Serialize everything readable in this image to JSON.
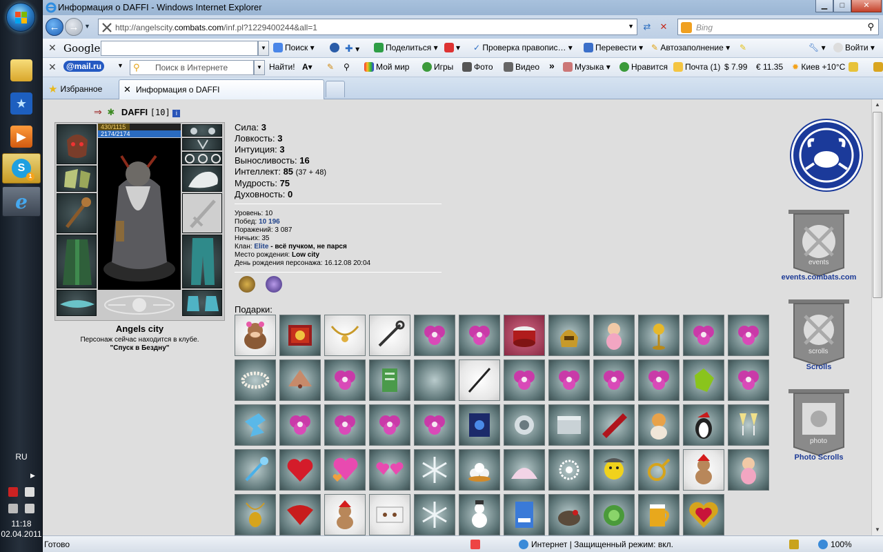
{
  "window": {
    "title": "Информация о DAFFI - Windows Internet Explorer",
    "minimize": "▁",
    "maximize": "□",
    "close": "✕"
  },
  "address": {
    "prefix": "http://angelscity.",
    "host": "combats.com",
    "path": "/inf.pl?1229400244&all=1"
  },
  "search": {
    "placeholder": "Bing"
  },
  "google_toolbar": {
    "logo": "Google",
    "search_label": "Поиск",
    "share_label": "Поделиться",
    "spellcheck_label": "Проверка правопис…",
    "translate_label": "Перевести",
    "autofill_label": "Автозаполнение",
    "login_label": "Войти"
  },
  "mail_toolbar": {
    "logo": "@mail.ru",
    "search_placeholder": "Поиск в Интернете",
    "go_label": "Найти!",
    "myworld_label": "Мой мир",
    "games_label": "Игры",
    "photo_label": "Фото",
    "video_label": "Видео",
    "more_label": "»",
    "music_label": "Музыка",
    "like_label": "Нравится",
    "mail_label": "Почта (1)",
    "usd_label": "$ 7.99",
    "eur_label": "€ 11.35",
    "weather_label": "Киев +10°C"
  },
  "tabs": {
    "favorites_label": "Избранное",
    "active_label": "Информация о DAFFI"
  },
  "character": {
    "name": "DAFFI",
    "level": "[10]",
    "info_icon": "i",
    "hp_text": "430/1115",
    "hp_fraction": 0.386,
    "mp_text": "2174/2174",
    "city_name": "Angels city",
    "location_text": "Персонаж сейчас находится в клубе.",
    "location_name": "\"Спуск в Бездну\""
  },
  "stats": [
    {
      "label": "Сила:",
      "value": "3",
      "extra": ""
    },
    {
      "label": "Ловкость:",
      "value": "3",
      "extra": ""
    },
    {
      "label": "Интуиция:",
      "value": "3",
      "extra": ""
    },
    {
      "label": "Выносливость:",
      "value": "16",
      "extra": ""
    },
    {
      "label": "Интеллект:",
      "value": "85",
      "extra": "(37 + 48)"
    },
    {
      "label": "Мудрость:",
      "value": "75",
      "extra": ""
    },
    {
      "label": "Духовность:",
      "value": "0",
      "extra": ""
    }
  ],
  "info": {
    "level_label": "Уровень:",
    "level_value": "10",
    "wins_label": "Побед:",
    "wins_value": "10 196",
    "losses_label": "Поражений:",
    "losses_value": "3 087",
    "draws_label": "Ничьих:",
    "draws_value": "35",
    "clan_label": "Клан:",
    "clan_name": "Elite",
    "clan_motto": "- всё пучком, не парся",
    "birthplace_label": "Место рождения:",
    "birthplace_value": "Low city",
    "birthday_label": "День рождения персонажа:",
    "birthday_value": "16.12.08 20:04"
  },
  "gifts_label": "Подарки:",
  "sidebar": {
    "events_caption": "events",
    "events_link": "events.combats.com",
    "scrolls_caption": "scrolls",
    "scrolls_link": "Scrolls",
    "photo_caption": "photo",
    "photo_link": "Photo Scrolls"
  },
  "status": {
    "text": "Готово",
    "zone": "Интернет | Защищенный режим: вкл.",
    "zoom": "100%"
  },
  "taskbar": {
    "lang": "RU",
    "time": "11:18",
    "date": "02.04.2011",
    "skype_badge": "1"
  },
  "colors": {
    "clan_blue": "#22448a",
    "link_blue": "#1c3a96",
    "gift_bg": "#5f7779"
  }
}
